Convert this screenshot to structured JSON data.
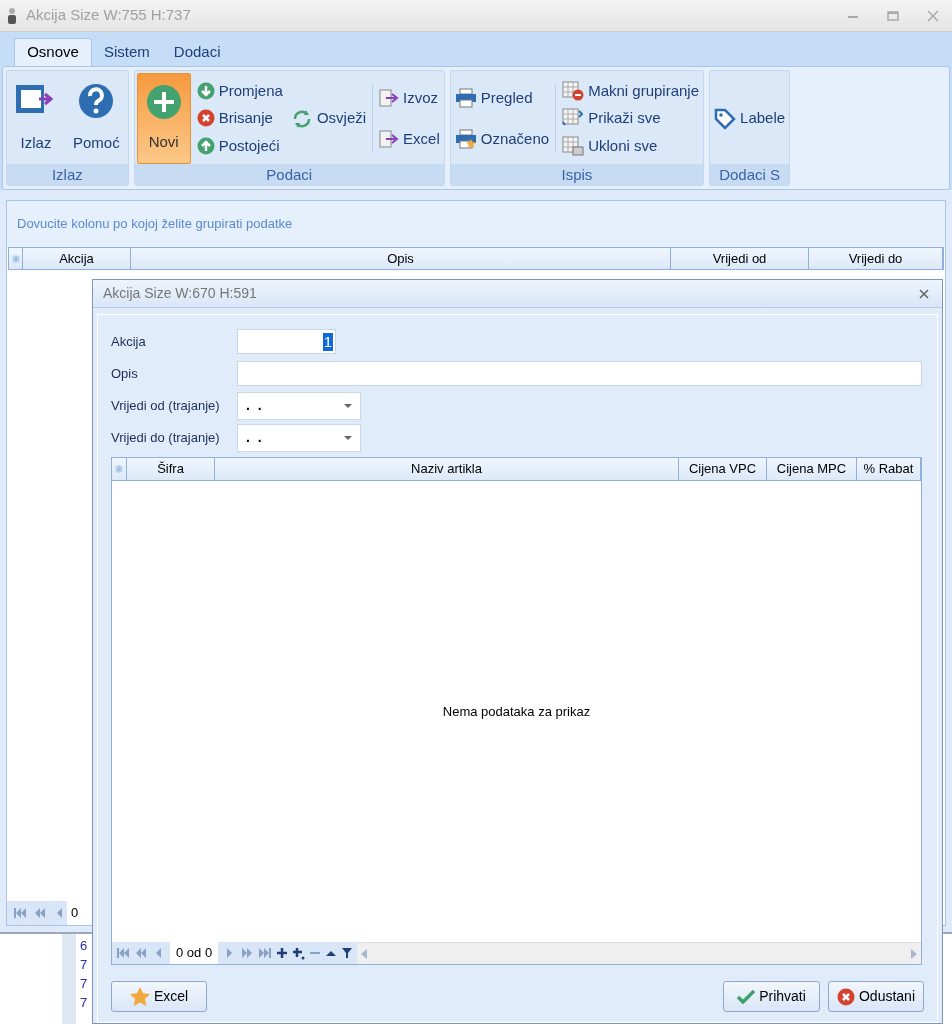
{
  "window": {
    "title": "Akcija Size W:755 H:737"
  },
  "ribbon": {
    "tabs": [
      {
        "label": "Osnove",
        "selected": true
      },
      {
        "label": "Sistem",
        "selected": false
      },
      {
        "label": "Dodaci",
        "selected": false
      }
    ],
    "groups": [
      {
        "title": "Izlaz",
        "columns": [
          {
            "kind": "large",
            "items": [
              {
                "label": "Izlaz",
                "highlighted": false
              }
            ]
          },
          {
            "kind": "large",
            "items": [
              {
                "label": "Pomoć",
                "highlighted": false
              }
            ]
          }
        ]
      },
      {
        "title": "Podaci",
        "columns": [
          {
            "kind": "large",
            "items": [
              {
                "label": "Novi",
                "highlighted": true
              }
            ]
          },
          {
            "kind": "stack",
            "items": [
              {
                "label": "Promjena"
              },
              {
                "label": "Brisanje"
              },
              {
                "label": "Postojeći"
              }
            ]
          },
          {
            "kind": "stack",
            "items": [
              {
                "label": "Osvježi"
              }
            ]
          },
          {
            "kind": "separator"
          },
          {
            "kind": "stack",
            "items": [
              {
                "label": "Izvoz"
              },
              {
                "label": "Excel"
              }
            ]
          }
        ]
      },
      {
        "title": "Ispis",
        "columns": [
          {
            "kind": "stack",
            "items": [
              {
                "label": "Pregled"
              },
              {
                "label": "Označeno"
              }
            ]
          },
          {
            "kind": "separator"
          },
          {
            "kind": "stack",
            "items": [
              {
                "label": "Makni grupiranje"
              },
              {
                "label": "Prikaži sve"
              },
              {
                "label": "Ukloni sve"
              }
            ]
          }
        ]
      },
      {
        "title": "Dodaci S",
        "columns": [
          {
            "kind": "stack",
            "items": [
              {
                "label": "Labele"
              }
            ]
          }
        ]
      }
    ]
  },
  "main_grid": {
    "group_hint": "Dovucite kolonu po kojoj želite grupirati podatke",
    "columns": [
      "Akcija",
      "Opis",
      "Vrijedi od",
      "Vrijedi do"
    ],
    "pager": "0"
  },
  "background_editor": {
    "line_numbers": [
      "6",
      "7",
      "7",
      "7"
    ]
  },
  "dialog": {
    "title": "Akcija Size W:670 H:591",
    "fields": [
      {
        "kind": "number",
        "label": "Akcija",
        "value": "1"
      },
      {
        "kind": "text",
        "label": "Opis"
      },
      {
        "kind": "date",
        "label": "Vrijedi od (trajanje)",
        "value": ". ."
      },
      {
        "kind": "date",
        "label": "Vrijedi do (trajanje)",
        "value": ". ."
      }
    ],
    "grid": {
      "columns": [
        "Šifra",
        "Naziv artikla",
        "Cijena VPC",
        "Cijena MPC",
        "% Rabat"
      ],
      "empty_text": "Nema podataka za prikaz",
      "pager": "0 od 0"
    },
    "buttons": [
      {
        "kind": "left",
        "label": "Excel"
      },
      {
        "kind": "accept",
        "label": "Prihvati"
      },
      {
        "kind": "cancel",
        "label": "Odustani"
      }
    ]
  }
}
